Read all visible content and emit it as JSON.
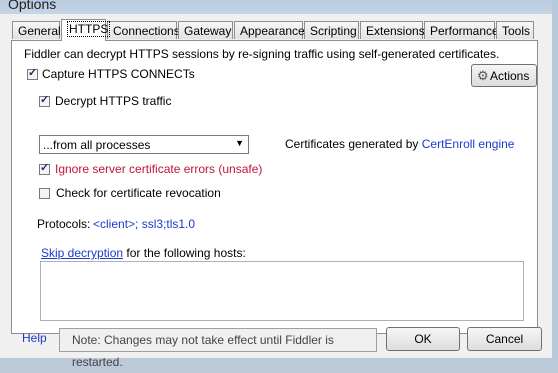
{
  "window": {
    "title": "Options"
  },
  "tabs": [
    "General",
    "HTTPS",
    "Connections",
    "Gateway",
    "Appearance",
    "Scripting",
    "Extensions",
    "Performance",
    "Tools"
  ],
  "https": {
    "description": "Fiddler can decrypt HTTPS sessions by re-signing traffic using self-generated certificates.",
    "capture_label": "Capture HTTPS CONNECTs",
    "capture_checked": true,
    "actions_label": "Actions",
    "decrypt_label": "Decrypt HTTPS traffic",
    "decrypt_checked": true,
    "process_select_value": "...from all processes",
    "certs_prefix": "Certificates generated by",
    "certs_engine_link": "CertEnroll engine",
    "ignore_errors_label": "Ignore server certificate errors (unsafe)",
    "ignore_errors_checked": true,
    "revocation_label": "Check for certificate revocation",
    "revocation_checked": false,
    "protocols_label": "Protocols:",
    "protocols_value": "<client>; ssl3;tls1.0",
    "skip_link": "Skip decryption",
    "skip_suffix": "for the following hosts:",
    "hosts_value": ""
  },
  "footer": {
    "help_label": "Help",
    "note": "Note: Changes may not take effect until Fiddler is restarted.",
    "ok_label": "OK",
    "cancel_label": "Cancel"
  },
  "colors": {
    "link": "#1a3bcc",
    "warning": "#c0143c",
    "titlebar": "#bcc9d8"
  }
}
